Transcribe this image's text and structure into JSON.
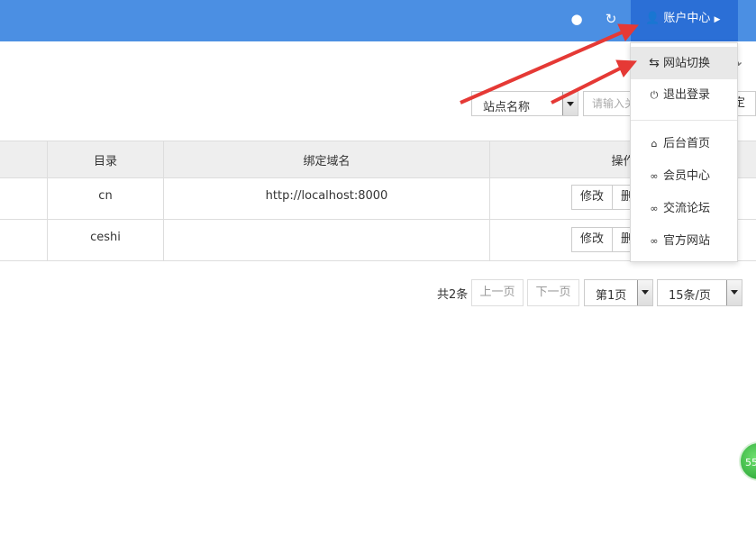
{
  "header": {
    "account_label": "账户中心",
    "icons": [
      "globe-icon",
      "refresh-icon",
      "user-icon"
    ]
  },
  "search": {
    "field_select": "站点名称",
    "input_placeholder": "请输入关",
    "confirm_label": "定"
  },
  "table": {
    "columns": [
      "目录",
      "绑定域名",
      "操作"
    ],
    "rows": [
      {
        "dir": "cn",
        "domain": "http://localhost:8000",
        "edit": "修改",
        "delete": "删"
      },
      {
        "dir": "ceshi",
        "domain": "",
        "edit": "修改",
        "delete": "删"
      }
    ]
  },
  "pagination": {
    "total": "共2条",
    "prev": "上一页",
    "next": "下一页",
    "page": "第1页",
    "per_page": "15条/页"
  },
  "dropdown": {
    "items": [
      {
        "icon": "switch-icon",
        "label": "网站切换",
        "active": true
      },
      {
        "icon": "power-icon",
        "label": "退出登录"
      },
      {
        "icon": "home-icon",
        "label": "后台首页"
      },
      {
        "icon": "link-icon",
        "label": "会员中心"
      },
      {
        "icon": "link-icon",
        "label": "交流论坛"
      },
      {
        "icon": "link-icon",
        "label": "官方网站"
      }
    ]
  },
  "badge": {
    "text": "55"
  },
  "colors": {
    "topbar": "#4b8fe3",
    "account_bg": "#2b6fd6",
    "annotation_arrow": "#e53935"
  }
}
